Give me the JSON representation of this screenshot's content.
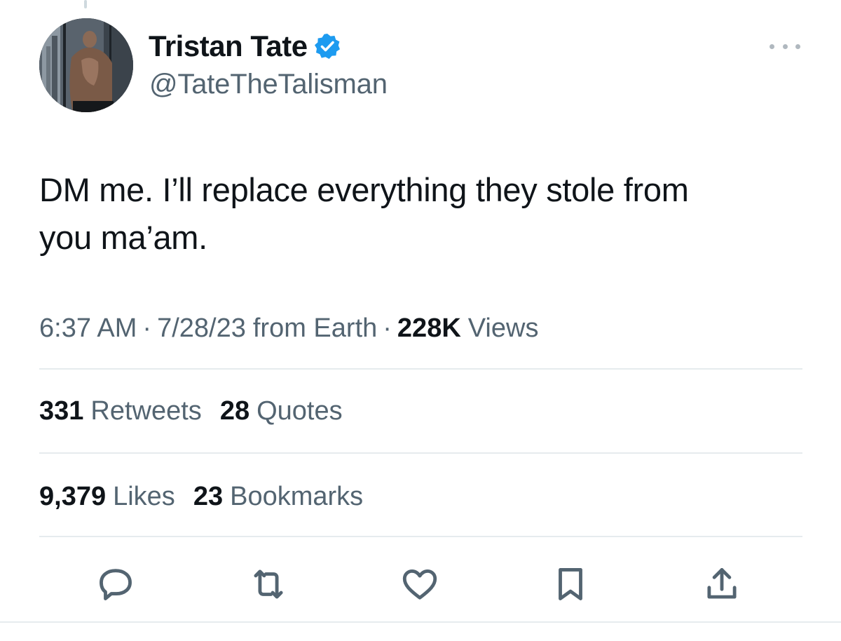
{
  "author": {
    "display_name": "Tristan Tate",
    "handle": "@TateTheTalisman",
    "verified": true,
    "verified_color": "#1d9bf0"
  },
  "tweet": {
    "text_line1": "DM me. I’ll replace everything they stole from",
    "text_line2": "you ma’am."
  },
  "meta": {
    "time": "6:37 AM",
    "separator": "·",
    "date": "7/28/23",
    "source": "from Earth",
    "views_count": "228K",
    "views_label": "Views"
  },
  "stats": {
    "retweets_count": "331",
    "retweets_label": "Retweets",
    "quotes_count": "28",
    "quotes_label": "Quotes",
    "likes_count": "9,379",
    "likes_label": "Likes",
    "bookmarks_count": "23",
    "bookmarks_label": "Bookmarks"
  },
  "actions": [
    {
      "name": "reply",
      "icon": "reply-icon"
    },
    {
      "name": "retweet",
      "icon": "retweet-icon"
    },
    {
      "name": "like",
      "icon": "heart-icon"
    },
    {
      "name": "bookmark",
      "icon": "bookmark-icon"
    },
    {
      "name": "share",
      "icon": "share-icon"
    }
  ],
  "colors": {
    "text_primary": "#0f1419",
    "text_secondary": "#536471",
    "divider": "#e6ebee",
    "verified_blue": "#1d9bf0"
  }
}
